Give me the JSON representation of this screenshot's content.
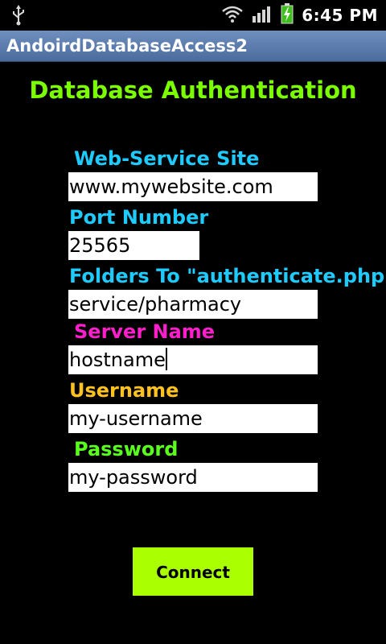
{
  "status_bar": {
    "usb_icon": "usb-icon",
    "wifi_icon": "wifi-icon",
    "signal_icon": "signal-bars-icon",
    "battery_icon": "battery-charging-icon",
    "time": "6:45 PM"
  },
  "app": {
    "title": "AndoirdDatabaseAccess2"
  },
  "form": {
    "heading": "Database Authentication",
    "fields": [
      {
        "label": "Web-Service Site",
        "value": "www.mywebsite.com",
        "label_color": "#1ecbff"
      },
      {
        "label": "Port Number",
        "value": "25565",
        "label_color": "#1ecbff"
      },
      {
        "label": "Folders To \"authenticate.php\"",
        "value": "service/pharmacy",
        "label_color": "#1ecbff"
      },
      {
        "label": "Server Name",
        "value": "hostname",
        "label_color": "#ff1ecb"
      },
      {
        "label": "Username",
        "value": "my-username",
        "label_color": "#ffc21e"
      },
      {
        "label": "Password",
        "value": "my-password",
        "label_color": "#5bff1e"
      }
    ],
    "connect_label": "Connect"
  },
  "colors": {
    "heading": "#7cfc00",
    "button": "#aaff00",
    "title_bar": "#5a7bab"
  }
}
